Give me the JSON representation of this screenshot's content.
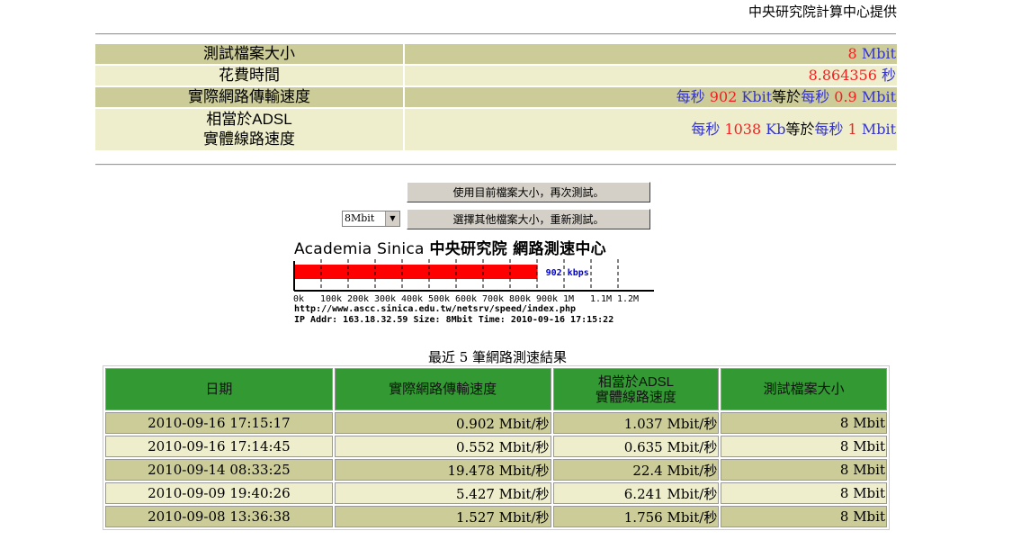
{
  "credit": "中央研究院計算中心提供",
  "info": [
    {
      "label": "測試檔案大小",
      "value": [
        {
          "t": "8",
          "c": "red"
        },
        {
          "t": " Mbit",
          "c": "b"
        }
      ]
    },
    {
      "label": "花費時間",
      "value": [
        {
          "t": "8.864356",
          "c": "red"
        },
        {
          "t": " 秒",
          "c": "b"
        }
      ]
    },
    {
      "label": "實際網路傳輸速度",
      "value": [
        {
          "t": "每秒 ",
          "c": "b"
        },
        {
          "t": "902",
          "c": "red"
        },
        {
          "t": " Kbit",
          "c": "b"
        },
        {
          "t": "等於",
          "c": ""
        },
        {
          "t": "每秒 ",
          "c": "b"
        },
        {
          "t": "0.9",
          "c": "red"
        },
        {
          "t": " Mbit",
          "c": "b"
        }
      ]
    },
    {
      "label": "相當於ADSL\n實體線路速度",
      "value": [
        {
          "t": "每秒 ",
          "c": "b"
        },
        {
          "t": "1038",
          "c": "red"
        },
        {
          "t": " Kb",
          "c": "b"
        },
        {
          "t": "等於",
          "c": ""
        },
        {
          "t": "每秒 ",
          "c": "b"
        },
        {
          "t": "1",
          "c": "red"
        },
        {
          "t": " Mbit",
          "c": "b"
        }
      ]
    }
  ],
  "buttons": {
    "retest": "使用目前檔案大小，再次測試。",
    "other": "選擇其他檔案大小，重新測試。"
  },
  "file_size_select": "8Mbit",
  "banner": {
    "title_latin": "Academia Sinica",
    "title_cjk": "中央研究院 網路測速中心",
    "speed_kbps": 902,
    "speed_label": "902 kbps",
    "ticks": [
      "0k",
      "100k",
      "200k",
      "300k",
      "400k",
      "500k",
      "600k",
      "700k",
      "800k",
      "900k",
      "1M",
      "1.1M",
      "1.2M"
    ],
    "url": "http://www.ascc.sinica.edu.tw/netsrv/speed/index.php",
    "info": "IP Addr: 163.18.32.59 Size: 8Mbit Time: 2010-09-16 17:15:22"
  },
  "recent": {
    "title": "最近 5 筆網路測速結果",
    "headers": [
      "日期",
      "實際網路傳輸速度",
      "相當於ADSL\n實體線路速度",
      "測試檔案大小"
    ],
    "rows": [
      [
        "2010-09-16 17:15:17",
        "0.902 Mbit/秒",
        "1.037 Mbit/秒",
        "8 Mbit"
      ],
      [
        "2010-09-16 17:14:45",
        "0.552 Mbit/秒",
        "0.635 Mbit/秒",
        "8 Mbit"
      ],
      [
        "2010-09-14 08:33:25",
        "19.478 Mbit/秒",
        "22.4 Mbit/秒",
        "8 Mbit"
      ],
      [
        "2010-09-09 19:40:26",
        "5.427 Mbit/秒",
        "6.241 Mbit/秒",
        "8 Mbit"
      ],
      [
        "2010-09-08 13:36:38",
        "1.527 Mbit/秒",
        "1.756 Mbit/秒",
        "8 Mbit"
      ]
    ]
  }
}
